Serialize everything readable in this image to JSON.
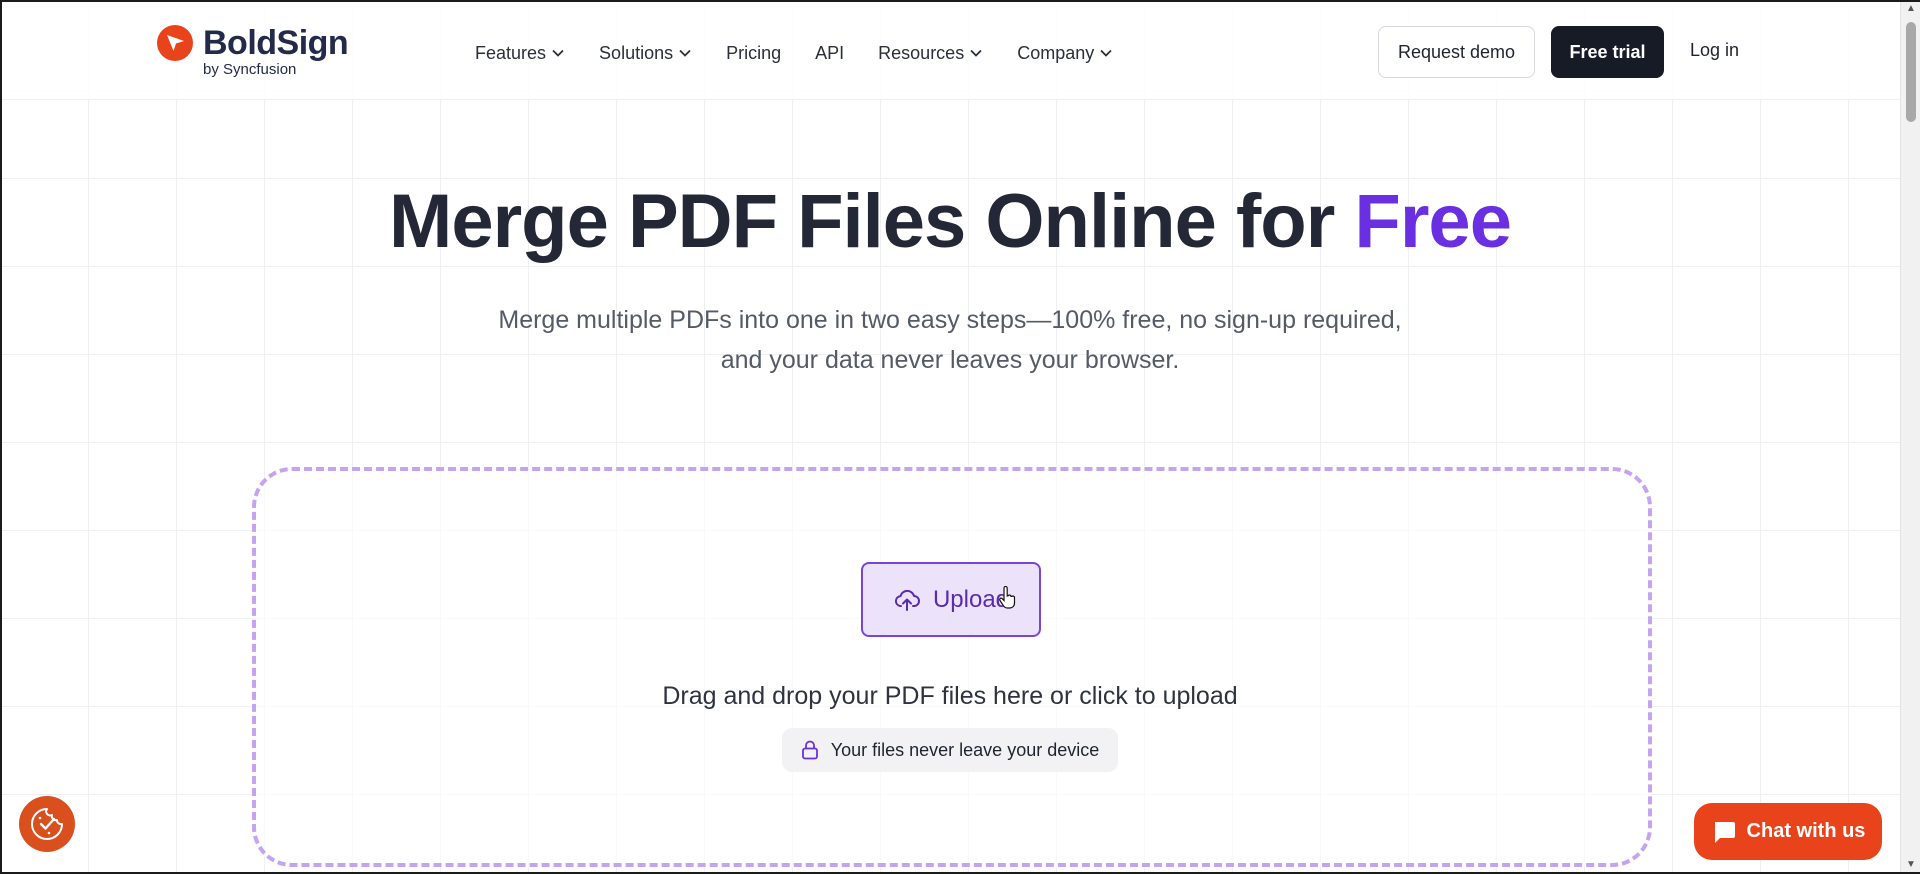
{
  "brand": {
    "name": "BoldSign",
    "sub": "by Syncfusion",
    "color": "#e8431b"
  },
  "nav": {
    "items": [
      {
        "label": "Features",
        "has_dropdown": true
      },
      {
        "label": "Solutions",
        "has_dropdown": true
      },
      {
        "label": "Pricing",
        "has_dropdown": false
      },
      {
        "label": "API",
        "has_dropdown": false
      },
      {
        "label": "Resources",
        "has_dropdown": true
      },
      {
        "label": "Company",
        "has_dropdown": true
      }
    ],
    "request_demo": "Request demo",
    "free_trial": "Free trial",
    "login": "Log in"
  },
  "hero": {
    "title_main": "Merge PDF Files Online for ",
    "title_accent": "Free",
    "accent_color": "#6a2fe0",
    "subtitle_line1": "Merge multiple PDFs into one in two easy steps—100% free, no sign-up required,",
    "subtitle_line2": "and your data never leaves your browser."
  },
  "dropzone": {
    "upload_label": "Upload",
    "drop_text": "Drag and drop your PDF files here or click to upload",
    "privacy_text": "Your files never leave your device",
    "border_color": "#c4a3f0"
  },
  "chat": {
    "label": "Chat with us"
  },
  "icons": {
    "logo": "boldsign-logo-icon",
    "upload": "cloud-upload-icon",
    "lock": "lock-icon",
    "cookie": "cookie-consent-icon",
    "chat": "chat-bubble-icon",
    "chevron": "chevron-down-icon"
  }
}
